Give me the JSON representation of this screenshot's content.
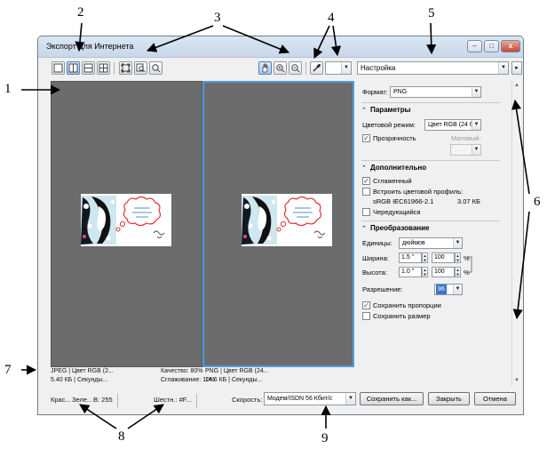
{
  "window": {
    "title": "Экспорт для Интернета",
    "buttons": {
      "minimize": "–",
      "maximize": "□",
      "close": "x"
    }
  },
  "toolbar": {
    "view_buttons": [
      "original-view",
      "2-up-vertical",
      "2-up-horizontal",
      "4-up"
    ],
    "zoom_buttons": [
      "fit",
      "zoom-100",
      "zoom-200"
    ],
    "tools": [
      "hand",
      "zoom-in",
      "zoom-out"
    ],
    "eyedropper_value": "",
    "preset": "Настройка",
    "preset_menu": "▸"
  },
  "info": {
    "left_line1_a": "JPEG  |  Цвет RGB (2...",
    "left_line1_b": "Качество: 80%",
    "left_line2_a": "5.40 КБ  |  Секунды...",
    "left_line2_b": "Сглаживание: 10%",
    "right_line1": "PNG  |  Цвет RGB (24...",
    "right_line2": "14.6 КБ  |  Секунды..."
  },
  "status": {
    "red": "Крас...",
    "green": "Зеле...",
    "blue": "В: 255",
    "hex": "Шестн.: #F...",
    "speed_label": "Скорость:",
    "speed_value": "Модем/ISDN 56 Кбит/с",
    "save_button": "Сохранить как...",
    "close_button": "Закрыть",
    "cancel_button": "Отмена"
  },
  "panel": {
    "format_label": "Формат:",
    "format_value": "PNG",
    "params_header": "Параметры",
    "color_mode_label": "Цветовой режим:",
    "color_mode_value": "Цвет RGB (24 б...",
    "transparency_label": "Прозрачность",
    "matte_label": "Матовый:",
    "extra_header": "Дополнительно",
    "antialias_label": "Сглаженный",
    "embed_profile_label": "Встроить цветовой профиль:",
    "profile_name": "sRGB IEC61966-2.1",
    "profile_size": "3.07 КБ",
    "interlaced_label": "Чередующийся",
    "transform_header": "Преобразование",
    "units_label": "Единицы:",
    "units_value": "дюймов",
    "width_label": "Ширина:",
    "width_value": "1.5 \"",
    "width_percent": "100",
    "height_label": "Высота:",
    "height_value": "1.0 \"",
    "height_percent": "100",
    "percent_sign": "%",
    "resolution_label": "Разрешение:",
    "resolution_value": "96",
    "keep_proportions_label": "Сохранить пропорции",
    "keep_size_label": "Сохранить размер",
    "checked": {
      "transparency": true,
      "antialias": true,
      "embed_profile": false,
      "interlaced": false,
      "keep_proportions": true,
      "keep_size": false
    }
  },
  "callouts": [
    "1",
    "2",
    "3",
    "4",
    "5",
    "6",
    "7",
    "8",
    "9"
  ],
  "colors": {
    "preview_bg": "#6c6c6c",
    "selected_border": "#4e9be0",
    "window_bg": "#f0f0f0"
  }
}
